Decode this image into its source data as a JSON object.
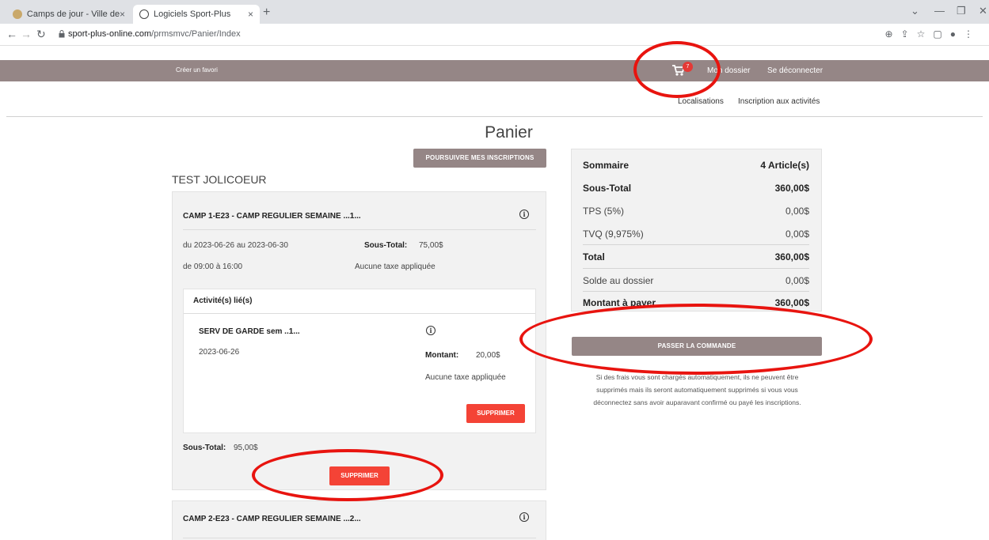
{
  "browser": {
    "tabs": [
      {
        "label": "Camps de jour - Ville de Lachute",
        "close": "×"
      },
      {
        "label": "Logiciels Sport-Plus",
        "close": "×"
      }
    ],
    "new_tab": "+",
    "url_host": "sport-plus-online.com",
    "url_path": "/prmsmvc/Panier/Index"
  },
  "topbar": {
    "favorite": "Créer un favori",
    "cart_count": "7",
    "my_file": "Mon dossier",
    "logout": "Se déconnecter"
  },
  "subnav": {
    "locations": "Localisations",
    "registration": "Inscription aux activités"
  },
  "page": {
    "title": "Panier",
    "continue_button": "POURSUIVRE MES INSCRIPTIONS",
    "person": "TEST JOLICOEUR"
  },
  "cart_items": [
    {
      "title": "CAMP 1-E23 - CAMP REGULIER SEMAINE ...1...",
      "dates": "du 2023-06-26 au 2023-06-30",
      "hours": "de 09:00 à 16:00",
      "subtotal_label": "Sous-Total:",
      "subtotal_value": "75,00$",
      "tax_note": "Aucune taxe appliquée",
      "linked_header": "Activité(s) lié(s)",
      "linked": {
        "title": "SERV DE GARDE sem ..1...",
        "date": "2023-06-26",
        "amount_label": "Montant:",
        "amount_value": "20,00$",
        "tax_note": "Aucune taxe appliquée",
        "delete": "SUPPRIMER"
      },
      "total_label": "Sous-Total:",
      "total_value": "95,00$",
      "delete": "SUPPRIMER"
    },
    {
      "title": "CAMP 2-E23 - CAMP REGULIER SEMAINE ...2..."
    }
  ],
  "summary": {
    "header_label": "Sommaire",
    "header_value": "4 Article(s)",
    "subtotal_label": "Sous-Total",
    "subtotal_value": "360,00$",
    "tps_label": "TPS (5%)",
    "tps_value": "0,00$",
    "tvq_label": "TVQ (9,975%)",
    "tvq_value": "0,00$",
    "total_label": "Total",
    "total_value": "360,00$",
    "balance_label": "Solde au dossier",
    "balance_value": "0,00$",
    "pay_label": "Montant à payer",
    "pay_value": "360,00$",
    "order_button": "PASSER LA COMMANDE"
  },
  "note": {
    "line1": "Si des frais vous sont chargés automatiquement, ils ne peuvent être",
    "line2": "supprimés mais ils seront automatiquement supprimés si vous vous",
    "line3": "déconnectez sans avoir auparavant confirmé ou payé les inscriptions."
  },
  "colors": {
    "brand_bar": "#958686",
    "delete_red": "#f44336",
    "annotation_red": "#e8140f"
  }
}
